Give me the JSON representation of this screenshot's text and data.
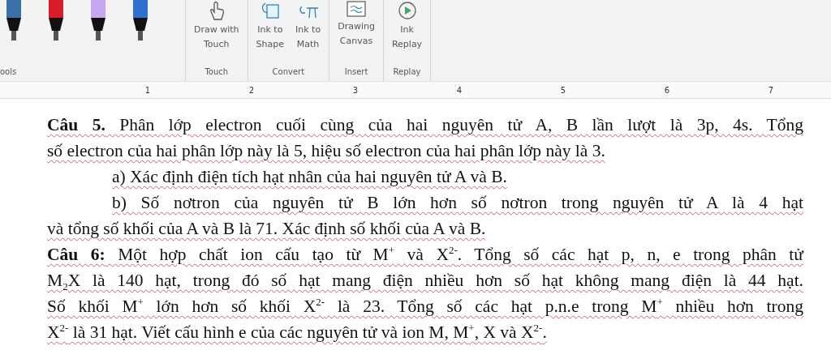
{
  "ribbon": {
    "pens": [
      {
        "color": "#3a6fa8"
      },
      {
        "color": "#d81c2a"
      },
      {
        "color": "#c6a8f0"
      },
      {
        "color": "#2f6fd0"
      }
    ],
    "pens_group_label": "ools",
    "groups": [
      {
        "label": "Touch",
        "buttons": [
          {
            "label": "Draw with\nTouch",
            "kind": "hand"
          }
        ]
      },
      {
        "label": "Convert",
        "buttons": [
          {
            "label": "Ink to\nShape",
            "kind": "shape"
          },
          {
            "label": "Ink to\nMath",
            "kind": "math"
          }
        ]
      },
      {
        "label": "Insert",
        "buttons": [
          {
            "label": "Drawing\nCanvas",
            "kind": "canvas"
          }
        ]
      },
      {
        "label": "Replay",
        "buttons": [
          {
            "label": "Ink\nReplay",
            "kind": "replay"
          }
        ]
      }
    ]
  },
  "ruler": {
    "numbers": [
      "1",
      "2",
      "3",
      "4",
      "5",
      "6",
      "7"
    ]
  },
  "document": {
    "paragraphs": [
      {
        "indent": false,
        "lines": [
          "**Câu 5.** Phân lớp electron cuối cùng của hai nguyên tử A, B lần lượt là 3p, 4s. Tổng",
          "số electron của hai phân lớp này là 5, hiệu số electron của hai phân lớp này là 3."
        ]
      },
      {
        "indent": true,
        "lines": [
          "a) Xác định điện tích hạt nhân của hai nguyên tử A và B."
        ]
      },
      {
        "indent": true,
        "lines": [
          "b) Số nơtron của nguyên tử B lớn hơn số nơtron trong nguyên tử A là 4 hạt",
          "và tổng số khối của A và B là 71. Xác định số khối của A và B."
        ]
      },
      {
        "indent": false,
        "lines": [
          "**Câu 6:** Một hợp chất ion cấu tạo từ M$^{+}$ và X$^{2-}$. Tổng số các hạt p, n, e trong phân tử",
          "M$_{2}$X là 140 hạt, trong đó số hạt mang điện nhiều hơn số hạt không mang điện là 44 hạt.",
          "Số khối M$^{+}$ lớn hơn số khối X$^{2-}$ là 23. Tổng số các hạt p.n.e trong M$^{+}$ nhiều hơn trong",
          "X$^{2-}$ là 31 hạt. Viết cấu hình e của các nguyên tử và ion M, M$^{+}$, X và X$^{2-}$."
        ]
      }
    ]
  }
}
